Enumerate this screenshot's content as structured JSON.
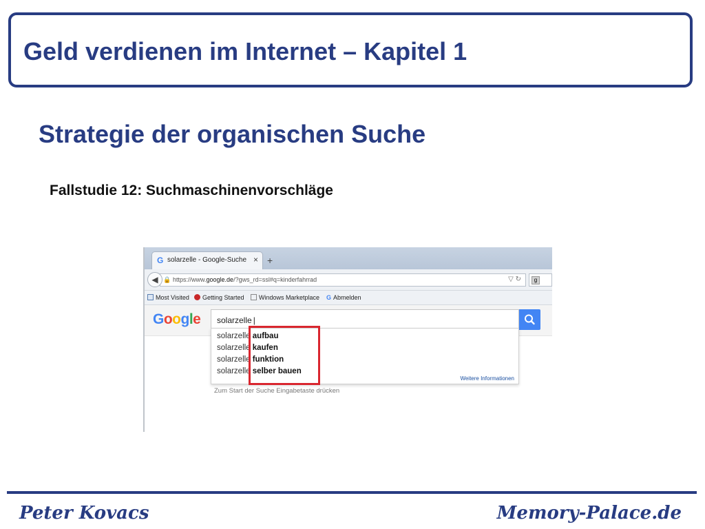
{
  "slide": {
    "title": "Geld verdienen im Internet – Kapitel 1",
    "subtitle": "Strategie der organischen Suche",
    "case_study": "Fallstudie 12: Suchmaschinenvorschläge",
    "footer_left": "Peter Kovacs",
    "footer_right": "Memory-Palace.de",
    "accent_color": "#283c82",
    "highlight_color": "#d9262f"
  },
  "browser": {
    "tab_title": "solarzelle - Google-Suche",
    "url_prefix": "https://www.",
    "url_domain": "google.de",
    "url_suffix": "/?gws_rd=ssl#q=kinderfahrrad",
    "bookmarks": [
      "Most Visited",
      "Getting Started",
      "Windows Marketplace",
      "Abmelden"
    ]
  },
  "google": {
    "logo": "Google",
    "query": "solarzelle",
    "suggestions": [
      {
        "prefix": "solarzelle",
        "suffix": "aufbau"
      },
      {
        "prefix": "solarzelle",
        "suffix": "kaufen"
      },
      {
        "prefix": "solarzelle",
        "suffix": "funktion"
      },
      {
        "prefix": "solarzelle",
        "suffix": "selber bauen"
      }
    ],
    "more_info": "Weitere Informationen",
    "hint": "Zum Start der Suche Eingabetaste drücken"
  }
}
